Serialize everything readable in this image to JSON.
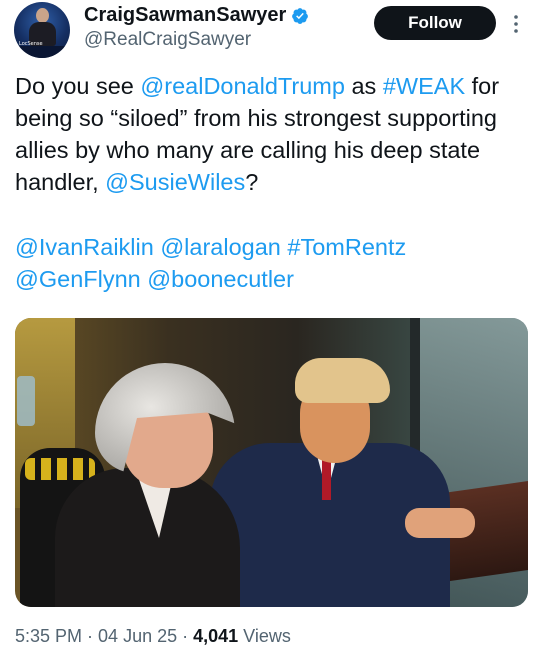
{
  "author": {
    "display_name": "CraigSawmanSawyer",
    "handle": "@RealCraigSawyer",
    "avatar_text": "LocSense"
  },
  "header": {
    "follow_label": "Follow"
  },
  "tweet": {
    "part1": "Do you see ",
    "mention1": "@realDonaldTrump",
    "part2": " as ",
    "hashtag1": "#WEAK",
    "part3": " for being so “siloed” from his strongest supporting allies by who many are calling his deep state handler, ",
    "mention2": "@SusieWiles",
    "part4": "?",
    "tag1": "@IvanRaiklin",
    "tag2": "@laralogan",
    "tag3": "#TomRentz",
    "tag4": "@GenFlynn",
    "tag5": "@boonecutler"
  },
  "meta": {
    "time": "5:35 PM",
    "sep1": " · ",
    "date": "04 Jun 25",
    "sep2": " · ",
    "views_count": "4,041",
    "views_label": " Views"
  },
  "colors": {
    "link": "#1d9bf0",
    "verified": "#1d9bf0",
    "text": "#0f1419",
    "muted": "#536471"
  },
  "icons": {
    "verified": "verified-badge-icon",
    "more": "more-vertical-icon"
  }
}
